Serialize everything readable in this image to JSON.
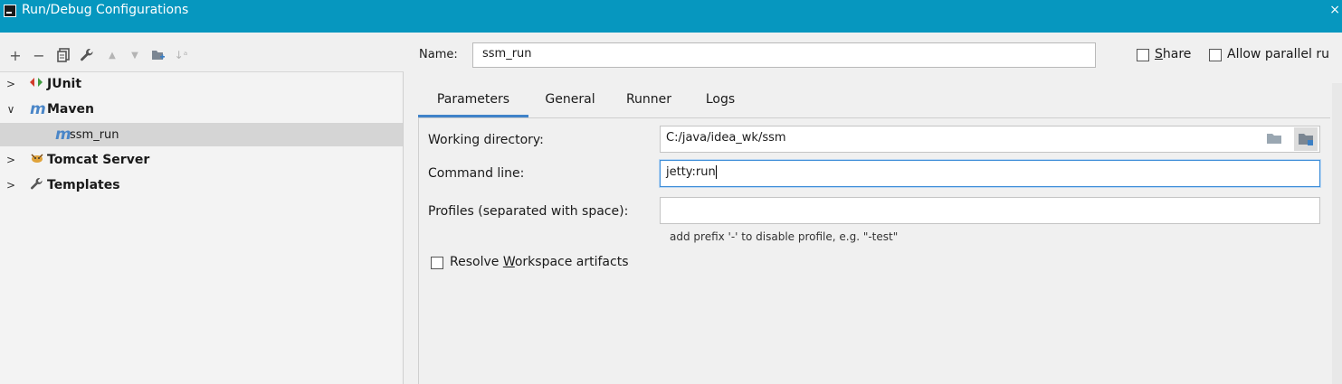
{
  "window": {
    "title": "Run/Debug Configurations",
    "close_glyph": "×"
  },
  "toolbar": {
    "buttons": [
      {
        "name": "add-icon",
        "glyph": "+"
      },
      {
        "name": "remove-icon",
        "glyph": "−"
      },
      {
        "name": "copy-icon",
        "glyph": "⧉"
      },
      {
        "name": "wrench-icon",
        "glyph": "🔧"
      },
      {
        "name": "move-up-icon",
        "glyph": "▲"
      },
      {
        "name": "move-down-icon",
        "glyph": "▼"
      },
      {
        "name": "new-folder-icon",
        "glyph": "▰"
      },
      {
        "name": "sort-icon",
        "glyph": "↓ᵃ"
      }
    ]
  },
  "tree": {
    "items": [
      {
        "label": "JUnit",
        "icon": "◆",
        "expanded": false
      },
      {
        "label": "Maven",
        "icon": "m",
        "expanded": true
      },
      {
        "label": "ssm_run",
        "icon": "m",
        "child": true,
        "selected": true
      },
      {
        "label": "Tomcat Server",
        "icon": "🐱",
        "expanded": false
      },
      {
        "label": "Templates",
        "icon": "🔧",
        "expanded": false
      }
    ]
  },
  "config": {
    "name_label": "Name:",
    "name_value": "ssm_run",
    "share_label_u": "S",
    "share_label_rest": "hare",
    "parallel_label": "Allow parallel ru"
  },
  "tabs": [
    "Parameters",
    "General",
    "Runner",
    "Logs"
  ],
  "form": {
    "working_dir_label": "Working directory:",
    "working_dir_value": "C:/java/idea_wk/ssm",
    "command_line_label": "Command line:",
    "command_line_value": "jetty:run",
    "profiles_label": "Profiles (separated with space):",
    "profiles_value": "",
    "profiles_hint": "add prefix '-' to disable profile, e.g. \"-test\"",
    "resolve_label_pre": "Resolve ",
    "resolve_label_u": "W",
    "resolve_label_post": "orkspace artifacts"
  },
  "colors": {
    "titlebar": "#0697bf",
    "tab_underline": "#4083c9",
    "maven_icon": "#4a86c8",
    "junit_icon": "#d23c2b"
  }
}
